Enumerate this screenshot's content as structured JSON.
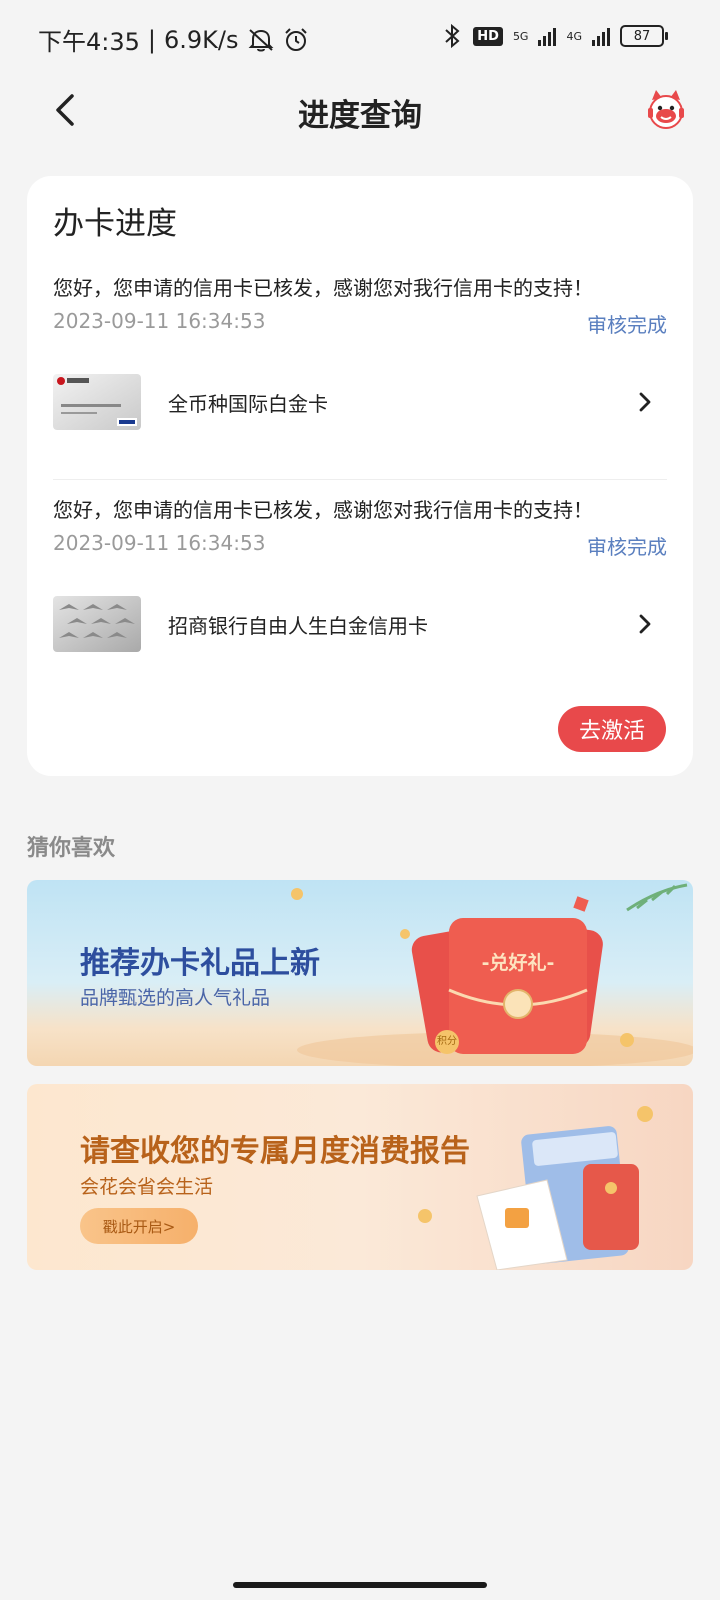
{
  "status_bar": {
    "time": "下午4:35",
    "separator": "|",
    "network_speed": "6.9K/s",
    "network_5g": "5G",
    "network_4g": "4G",
    "hd_label": "HD",
    "battery": "87"
  },
  "nav": {
    "title": "进度查询"
  },
  "progress_card": {
    "title": "办卡进度",
    "items": [
      {
        "message": "您好，您申请的信用卡已核发，感谢您对我行信用卡的支持！",
        "time": "2023-09-11 16:34:53",
        "status": "审核完成",
        "card_name": "全币种国际白金卡"
      },
      {
        "message": "您好，您申请的信用卡已核发，感谢您对我行信用卡的支持！",
        "time": "2023-09-11 16:34:53",
        "status": "审核完成",
        "card_name": "招商银行自由人生白金信用卡"
      }
    ],
    "activate_label": "去激活"
  },
  "recommend": {
    "section_title": "猜你喜欢",
    "banners": [
      {
        "title": "推荐办卡礼品上新",
        "subtitle": "品牌甄选的高人气礼品",
        "badge": "-兑好礼-",
        "points_tag": "积分"
      },
      {
        "title": "请查收您的专属月度消费报告",
        "subtitle": "会花会省会生活",
        "button": "戳此开启>"
      }
    ]
  },
  "colors": {
    "accent_red": "#e8494b",
    "status_blue": "#5a7fbf",
    "page_bg": "#f4f4f4"
  }
}
